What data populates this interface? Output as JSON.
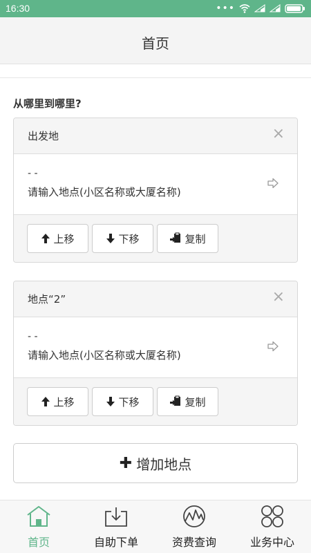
{
  "status": {
    "time": "16:30"
  },
  "header": {
    "title": "首页"
  },
  "main": {
    "section_title": "从哪里到哪里?",
    "panels": [
      {
        "title": "出发地",
        "close_icon": "×",
        "dash": "- -",
        "location_placeholder": "请输入地点(小区名称或大厦名称)",
        "buttons": {
          "up": "上移",
          "down": "下移",
          "copy": "复制"
        }
      },
      {
        "title": "地点“2”",
        "close_icon": "×",
        "dash": "- -",
        "location_placeholder": "请输入地点(小区名称或大厦名称)",
        "buttons": {
          "up": "上移",
          "down": "下移",
          "copy": "复制"
        }
      }
    ],
    "add_button": {
      "icon": "✚",
      "label": "增加地点"
    }
  },
  "tabbar": {
    "accent_color": "#5fb58a",
    "items": [
      {
        "label": "首页",
        "icon": "home-icon",
        "active": true
      },
      {
        "label": "自助下单",
        "icon": "download-tray-icon",
        "active": false
      },
      {
        "label": "资费查询",
        "icon": "wave-circle-icon",
        "active": false
      },
      {
        "label": "业务中心",
        "icon": "four-circles-icon",
        "active": false
      }
    ]
  }
}
